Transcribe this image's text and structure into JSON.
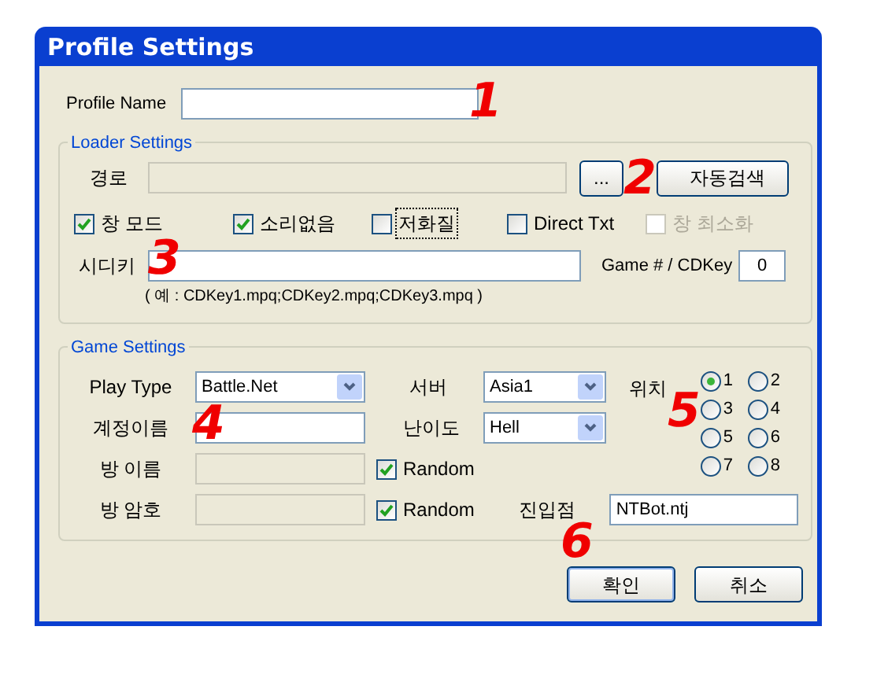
{
  "window": {
    "title": "Profile Settings"
  },
  "profile_name": {
    "label": "Profile Name"
  },
  "loader_settings": {
    "title": "Loader Settings",
    "path": {
      "label": "경로",
      "disabled": true
    },
    "browse_button": "...",
    "auto_search_button": "자동검색",
    "options": [
      {
        "label": "창 모드",
        "checked": true,
        "disabled": false,
        "focused": false
      },
      {
        "label": "소리없음",
        "checked": true,
        "disabled": false,
        "focused": false
      },
      {
        "label": "저화질",
        "checked": false,
        "disabled": false,
        "focused": true
      },
      {
        "label": "Direct Txt",
        "checked": false,
        "disabled": false,
        "focused": false
      },
      {
        "label": "창 최소화",
        "checked": false,
        "disabled": true,
        "focused": false
      }
    ],
    "cdkey": {
      "label": "시디키"
    },
    "game_cdkey": {
      "label": "Game # / CDKey",
      "value": "0"
    },
    "hint": "( 예 : CDKey1.mpq;CDKey2.mpq;CDKey3.mpq )"
  },
  "game_settings": {
    "title": "Game Settings",
    "play_type": {
      "label": "Play Type",
      "value": "Battle.Net"
    },
    "server": {
      "label": "서버",
      "value": "Asia1"
    },
    "account": {
      "label": "계정이름"
    },
    "difficulty": {
      "label": "난이도",
      "value": "Hell"
    },
    "room_name": {
      "label": "방 이름",
      "disabled": true,
      "random": {
        "label": "Random",
        "checked": true
      }
    },
    "room_password": {
      "label": "방 암호",
      "disabled": true,
      "random": {
        "label": "Random",
        "checked": true
      }
    },
    "entry_point": {
      "label": "진입점",
      "value": "NTBot.ntj"
    },
    "position": {
      "label": "위치",
      "options": [
        {
          "label": "1",
          "selected": true
        },
        {
          "label": "2",
          "selected": false
        },
        {
          "label": "3",
          "selected": false
        },
        {
          "label": "4",
          "selected": false
        },
        {
          "label": "5",
          "selected": false
        },
        {
          "label": "6",
          "selected": false
        },
        {
          "label": "7",
          "selected": false
        },
        {
          "label": "8",
          "selected": false
        }
      ]
    }
  },
  "buttons": [
    {
      "label": "확인",
      "default": true
    },
    {
      "label": "취소",
      "default": false
    }
  ],
  "annotations": [
    {
      "text": "1"
    },
    {
      "text": "2"
    },
    {
      "text": "3"
    },
    {
      "text": "4"
    },
    {
      "text": "5"
    },
    {
      "text": "6"
    }
  ]
}
